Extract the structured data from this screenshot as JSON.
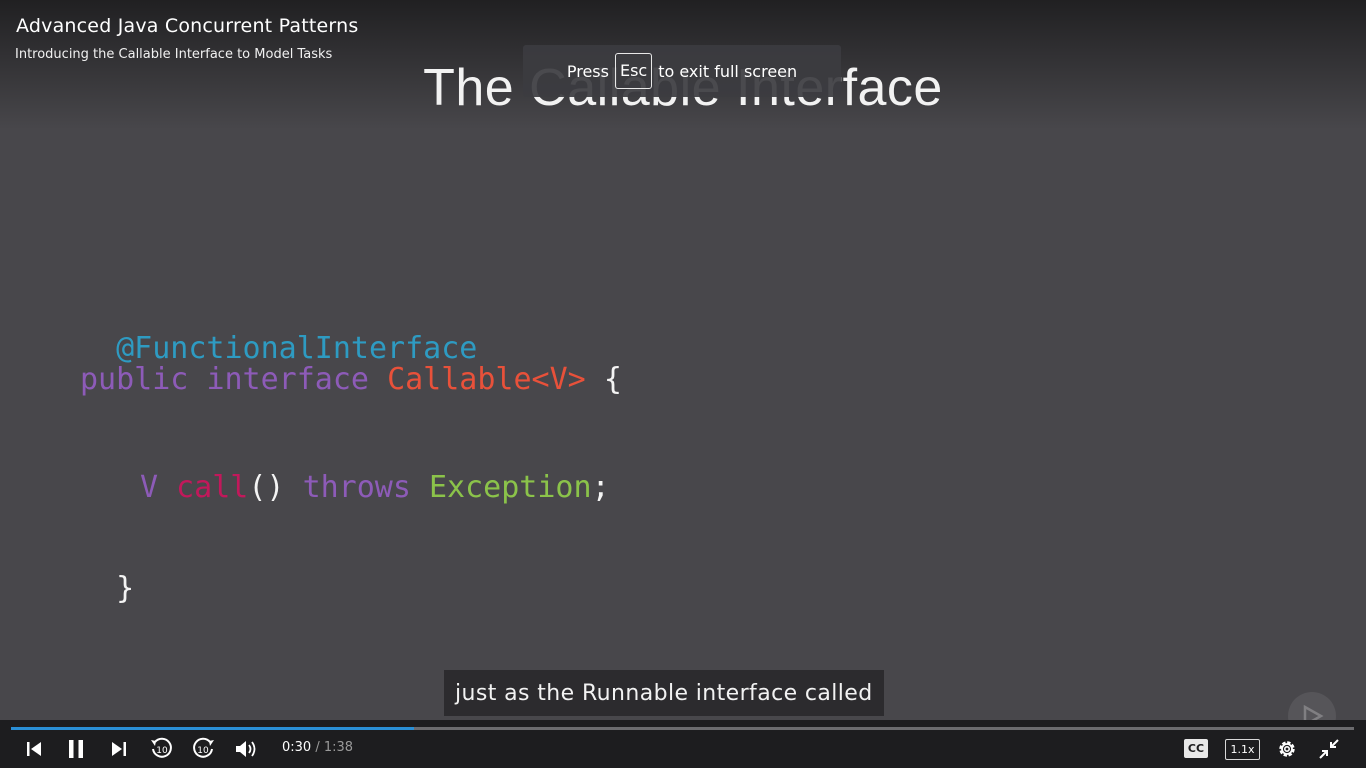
{
  "header": {
    "course_title": "Advanced Java Concurrent Patterns",
    "clip_title": "Introducing the Callable Interface to Model Tasks"
  },
  "slide": {
    "title": "The Callable Interface",
    "code": {
      "annotation": "@FunctionalInterface",
      "kw_public": "public",
      "kw_interface": "interface",
      "type_decl": "Callable<V>",
      "open_brace": "{",
      "type_v": "V",
      "method": "call",
      "parens": "()",
      "kw_throws": "throws",
      "exception": "Exception",
      "semicolon": ";",
      "close_brace": "}"
    }
  },
  "fullscreen_toast": {
    "press": "Press",
    "key": "Esc",
    "suffix": "to exit full screen"
  },
  "caption": "just as the Runnable interface called",
  "player": {
    "current_time": "0:30",
    "separator": "/",
    "duration": "1:38",
    "progress_fraction": 0.3,
    "cc_label": "CC",
    "speed_label": "1.1x",
    "rewind_seconds": "10",
    "forward_seconds": "10",
    "colors": {
      "progress": "#2a8fd6",
      "track": "#6b6b6e",
      "bar_bg": "#1d1d1f"
    },
    "icons": [
      "previous-icon",
      "pause-icon",
      "next-icon",
      "rewind-10-icon",
      "forward-10-icon",
      "volume-icon",
      "closed-captions-icon",
      "speed-icon",
      "settings-gear-icon",
      "exit-fullscreen-icon"
    ]
  }
}
